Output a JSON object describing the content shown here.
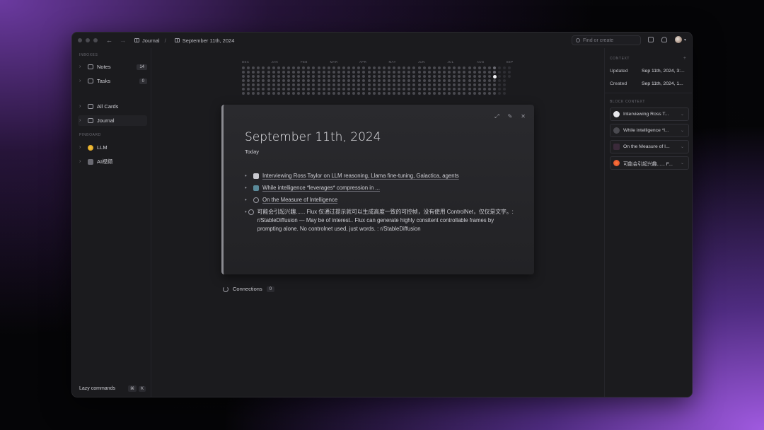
{
  "titlebar": {
    "breadcrumb_parent": "Journal",
    "breadcrumb_current": "September 11th, 2024",
    "search_placeholder": "Find or create"
  },
  "sidebar": {
    "inboxes_label": "INBOXES",
    "notes_label": "Notes",
    "notes_count": "14",
    "tasks_label": "Tasks",
    "tasks_count": "0",
    "all_cards_label": "All Cards",
    "journal_label": "Journal",
    "pinboard_label": "PINBOARD",
    "pin_llm": "LLM",
    "pin_ai_video": "AI视频",
    "lazy_commands": "Lazy commands",
    "kbd_cmd": "⌘",
    "kbd_k": "K"
  },
  "heatmap": {
    "months": [
      "DEC",
      "JAN",
      "FEB",
      "MAR",
      "APR",
      "MAY",
      "JUN",
      "JUL",
      "AUG",
      "SEP"
    ]
  },
  "card": {
    "title": "September 11th, 2024",
    "subtitle": "Today",
    "bullets": [
      "Interviewing Ross Taylor on LLM reasoning, Llama fine-tuning, Galactica, agents",
      "While intelligence *leverages* compression in ...",
      "On the Measure of Intelligence",
      "可能会引起兴趣...... Flux 仅通过提示就可以生成高度一致的可控帧，没有使用 ControlNet，仅仅是文字。: r/StableDiffusion --- May be of interest.. Flux can generate highly consitent controllable frames by prompting alone. No controlnet used, just words. : r/StableDiffusion"
    ]
  },
  "connections": {
    "label": "Connections",
    "count": "0"
  },
  "context_panel": {
    "context_label": "CONTEXT",
    "updated_key": "Updated",
    "updated_value": "Sep 11th, 2024, 3:...",
    "created_key": "Created",
    "created_value": "Sep 11th, 2024, 1...",
    "block_context_label": "BLOCK CONTEXT",
    "items": [
      "Interviewing Ross T...",
      "While intelligence *l...",
      "On the Measure of I...",
      "可能会引起兴趣...... F..."
    ]
  },
  "colors": {
    "window_bg": "#1b1b1e",
    "card_bg": "#2a2a2e",
    "text": "#d8d8dc",
    "muted": "#6a6a72"
  }
}
